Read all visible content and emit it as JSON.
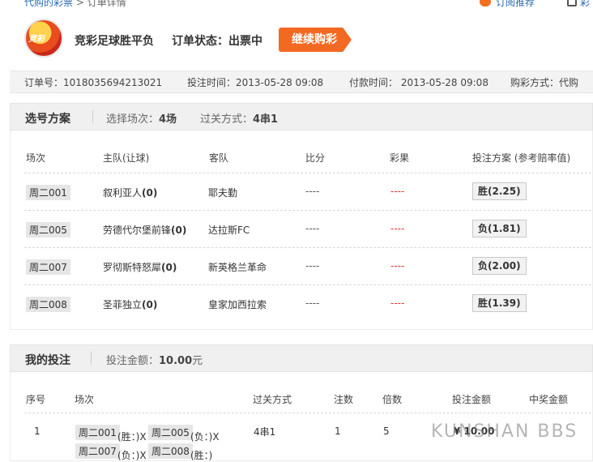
{
  "breadcrumb": {
    "link": "代购的彩票",
    "current": "> 订单详情"
  },
  "topright": {
    "link1": "订阅推荐",
    "link2": "彩"
  },
  "header": {
    "logo_text": "竞彩",
    "title": "竞彩足球胜平负",
    "status": "订单状态：出票中",
    "continue_button": "继续购彩"
  },
  "info": {
    "order_no": "订单号：1018035694213021",
    "bet_time": "投注时间：2013-05-28 09:08",
    "pay_time": "付款时间： 2013-05-28 09:08",
    "buy_method": "购彩方式：代购"
  },
  "plan": {
    "title": "选号方案",
    "match_count_label": "选择场次：",
    "match_count": "4场",
    "pass_label": "过关方式：",
    "pass": "4串1",
    "headers": [
      "场次",
      "主队(让球)",
      "客队",
      "比分",
      "彩果",
      "投注方案 (参考赔率值)"
    ],
    "rows": [
      {
        "match": "周二001",
        "home": "叙利亚人",
        "handicap": "(0)",
        "away": "耶夫勤",
        "score": "----",
        "result": "----",
        "pick": "胜(2.25)"
      },
      {
        "match": "周二005",
        "home": "劳德代尔堡前锋",
        "handicap": "(0)",
        "away": "达拉斯FC",
        "score": "----",
        "result": "----",
        "pick": "负(1.81)"
      },
      {
        "match": "周二007",
        "home": "罗彻斯特怒犀",
        "handicap": "(0)",
        "away": "新英格兰革命",
        "score": "----",
        "result": "----",
        "pick": "负(2.00)"
      },
      {
        "match": "周二008",
        "home": "圣菲独立",
        "handicap": "(0)",
        "away": "皇家加西拉索",
        "score": "----",
        "result": "----",
        "pick": "胜(1.39)"
      }
    ]
  },
  "mybet": {
    "title": "我的投注",
    "amount_label": "投注金额：",
    "amount": "10.00",
    "amount_unit": "元",
    "headers": [
      "序号",
      "场次",
      "过关方式",
      "注数",
      "倍数",
      "投注金额",
      "中奖金额"
    ],
    "row": {
      "index": "1",
      "m1": "周二001",
      "m1r": "(胜：)X",
      "m2": "周二005",
      "m2r": "(负：)X",
      "m3": "周二007",
      "m3r": "(负：)X",
      "m4": "周二008",
      "m4r": "(胜：)",
      "pass": "4串1",
      "notes": "1",
      "multiple": "5",
      "amount": "¥ 10.00"
    }
  },
  "watermark": "KUNSHAN BBS"
}
